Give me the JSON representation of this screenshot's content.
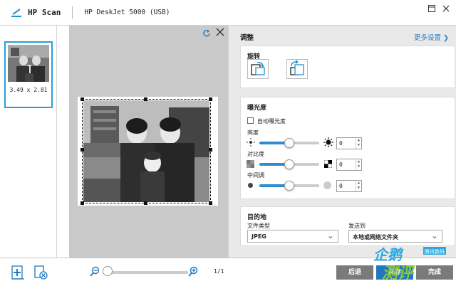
{
  "titlebar": {
    "app_title": "HP Scan",
    "device_name": "HP DeskJet 5000 (USB)",
    "icons": [
      "scanner-logo-icon",
      "restore-window-icon",
      "close-window-icon"
    ]
  },
  "thumbnails": {
    "items": [
      {
        "size_label": "3.49  x  2.81"
      }
    ]
  },
  "preview": {
    "icons": [
      "rotate-preview-icon",
      "close-preview-icon"
    ]
  },
  "settings": {
    "title": "调整",
    "more_link": "更多设置 ❯",
    "rotate": {
      "title": "旋转"
    },
    "exposure": {
      "title": "曝光度",
      "auto_label": "自动曝光度",
      "auto_checked": false,
      "brightness": {
        "label": "亮度",
        "value": "0",
        "level": 0.5
      },
      "contrast": {
        "label": "对比度",
        "value": "0",
        "level": 0.5
      },
      "midtone": {
        "label": "中间调",
        "value": "0",
        "level": 0.5
      }
    },
    "destination": {
      "title": "目的地",
      "file_type_label": "文件类型",
      "file_type_value": "JPEG",
      "send_to_label": "发送到",
      "send_to_value": "本地或网络文件夹"
    }
  },
  "bottom": {
    "page_counter": "1/1",
    "back_label": "后退",
    "save_label": "保存",
    "extra_label": "完成",
    "zoom_level": 0.0
  },
  "colors": {
    "accent": "#2a8fd0",
    "link": "#2a7fc0",
    "back_button": "#7a7a7a",
    "save_button": "#1f78c1",
    "panel_bg": "#e9e9e9",
    "preview_bg": "#c9c9c9"
  },
  "watermark": {
    "text": "企鹅测评",
    "subtext": "腾讯数码"
  }
}
